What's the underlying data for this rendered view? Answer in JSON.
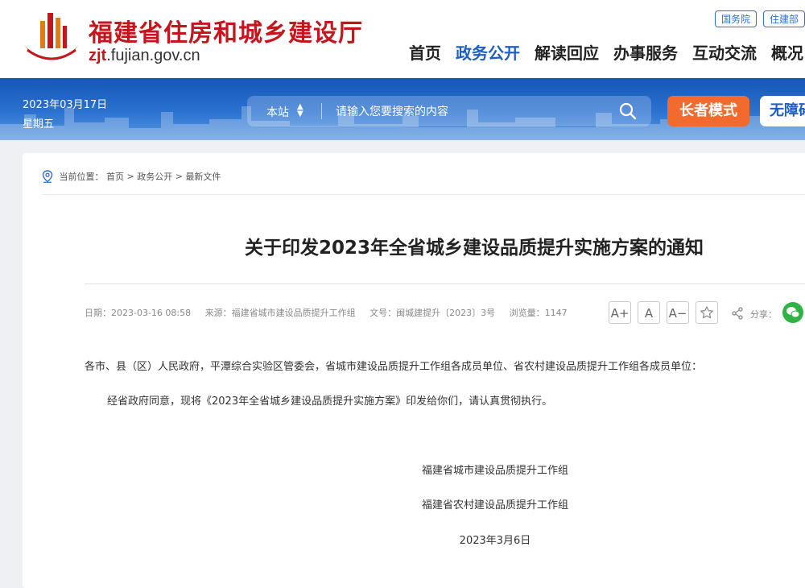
{
  "header": {
    "site_title": "福建省住房和城乡建设厅",
    "url_prefix": "zjt",
    "url_rest": ".fujian.gov.cn",
    "quick_links": [
      "国务院",
      "住建部"
    ],
    "nav": [
      "首页",
      "政务公开",
      "解读回应",
      "办事服务",
      "互动交流",
      "概况"
    ],
    "active_nav": "政务公开"
  },
  "banner": {
    "date": "2023年03月17日",
    "weekday": "星期五",
    "search_scope": "本站",
    "search_placeholder": "请输入您要搜索的内容",
    "elder_mode": "长者模式",
    "accessibility": "无障碍"
  },
  "breadcrumb": {
    "label": "当前位置：",
    "items": [
      "首页",
      "政务公开",
      "最新文件"
    ],
    "separator": ">"
  },
  "article": {
    "title": "关于印发2023年全省城乡建设品质提升实施方案的通知",
    "meta": {
      "date": "日期：2023-03-16 08:58",
      "source": "来源：福建省城市建设品质提升工作组",
      "doc_no": "文号：闽城建提升〔2023〕3号",
      "views": "浏览量：1147"
    },
    "tools": [
      "A+",
      "A",
      "A−"
    ],
    "share_label": "分享：",
    "salutation": "各市、县（区）人民政府，平潭综合实验区管委会，省城市建设品质提升工作组各成员单位、省农村建设品质提升工作组各成员单位：",
    "body": "经省政府同意，现将《2023年全省城乡建设品质提升实施方案》印发给你们，请认真贯彻执行。",
    "signatures": [
      "福建省城市建设品质提升工作组",
      "福建省农村建设品质提升工作组"
    ],
    "sign_date": "2023年3月6日"
  },
  "colors": {
    "brand_red": "#c4161c",
    "nav_blue": "#1f5fc2",
    "banner_blue": "#1556b7",
    "elder_orange": "#f26a2e",
    "wechat_green": "#2fb344"
  }
}
